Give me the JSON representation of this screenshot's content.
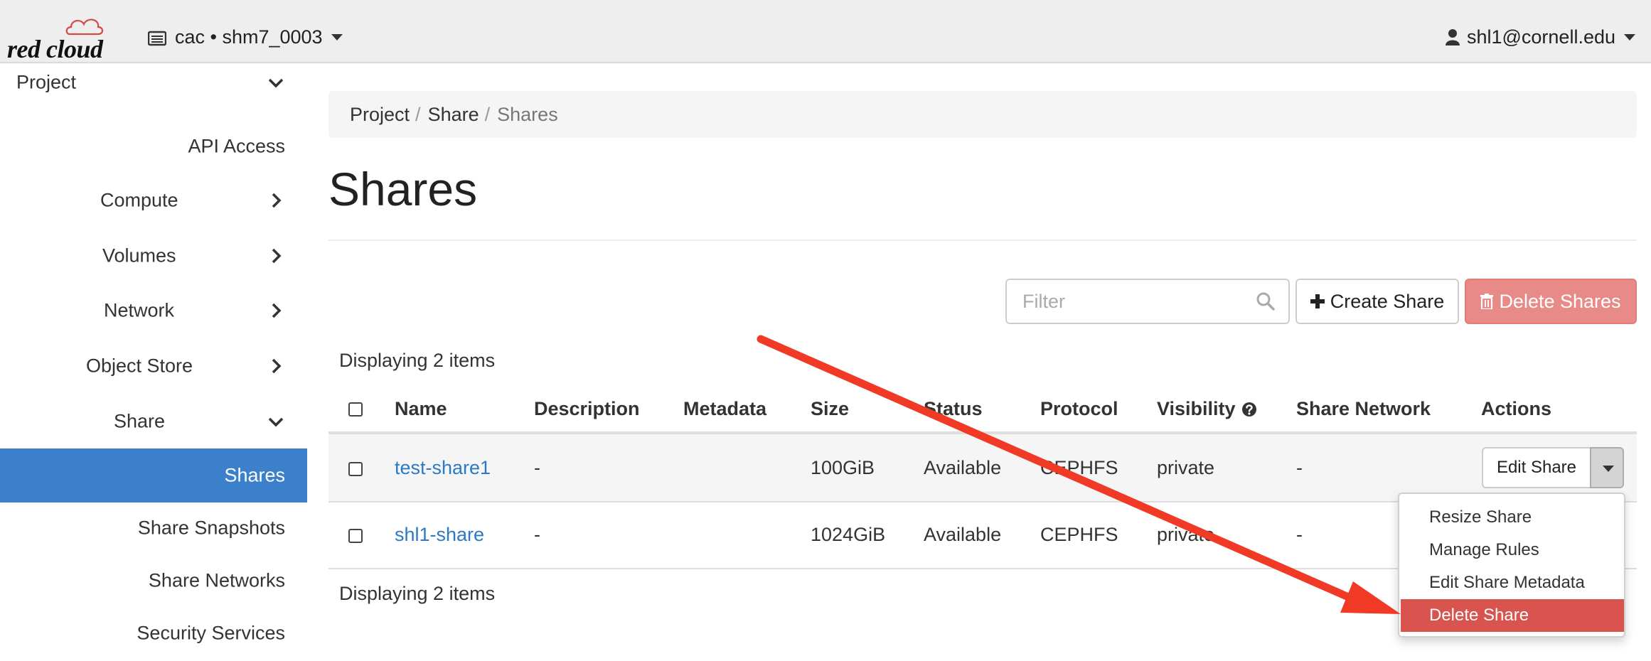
{
  "topbar": {
    "logo_text": "red cloud",
    "project_picker_label": "cac • shm7_0003",
    "user_label": "shl1@cornell.edu"
  },
  "sidebar": {
    "items": [
      {
        "label": "Project",
        "chevron": "down"
      },
      {
        "label": "API Access",
        "chevron": "none"
      },
      {
        "label": "Compute",
        "chevron": "right"
      },
      {
        "label": "Volumes",
        "chevron": "right"
      },
      {
        "label": "Network",
        "chevron": "right"
      },
      {
        "label": "Object Store",
        "chevron": "right"
      },
      {
        "label": "Share",
        "chevron": "down"
      },
      {
        "label": "Shares",
        "chevron": "none",
        "active": true
      },
      {
        "label": "Share Snapshots",
        "chevron": "none"
      },
      {
        "label": "Share Networks",
        "chevron": "none"
      },
      {
        "label": "Security Services",
        "chevron": "none"
      }
    ]
  },
  "breadcrumb": {
    "items": [
      "Project",
      "Share",
      "Shares"
    ],
    "separator": "/"
  },
  "page": {
    "title": "Shares"
  },
  "toolbar": {
    "filter_placeholder": "Filter",
    "create_label": "Create Share",
    "delete_label": "Delete Shares"
  },
  "table": {
    "count_top": "Displaying 2 items",
    "count_bottom": "Displaying 2 items",
    "columns": [
      "Name",
      "Description",
      "Metadata",
      "Size",
      "Status",
      "Protocol",
      "Visibility",
      "Share Network",
      "Actions"
    ],
    "rows": [
      {
        "name": "test-share1",
        "description": "-",
        "metadata": "",
        "size": "100GiB",
        "status": "Available",
        "protocol": "CEPHFS",
        "visibility": "private",
        "share_network": "-",
        "action": "Edit Share"
      },
      {
        "name": "shl1-share",
        "description": "-",
        "metadata": "",
        "size": "1024GiB",
        "status": "Available",
        "protocol": "CEPHFS",
        "visibility": "private",
        "share_network": "-",
        "action": ""
      }
    ]
  },
  "actions_menu": {
    "items": [
      "Resize Share",
      "Manage Rules",
      "Edit Share Metadata",
      "Delete Share"
    ],
    "highlighted": "Delete Share"
  },
  "colors": {
    "active_nav": "#3c7fcb",
    "link": "#2a7ac6",
    "danger": "#d9534f",
    "annotation_arrow": "#f03a26"
  }
}
